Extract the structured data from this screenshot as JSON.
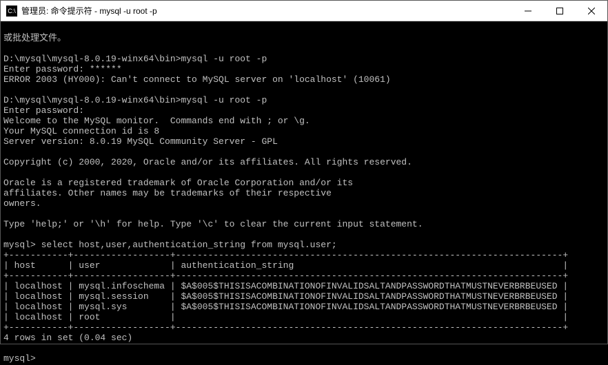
{
  "window": {
    "title": "管理员: 命令提示符 - mysql  -u root -p"
  },
  "term": {
    "l0": "或批处理文件。",
    "blank": "",
    "l1": "D:\\mysql\\mysql-8.0.19-winx64\\bin>mysql -u root -p",
    "l2": "Enter password: ******",
    "l3": "ERROR 2003 (HY000): Can't connect to MySQL server on 'localhost' (10061)",
    "l4": "D:\\mysql\\mysql-8.0.19-winx64\\bin>mysql -u root -p",
    "l5": "Enter password:",
    "l6": "Welcome to the MySQL monitor.  Commands end with ; or \\g.",
    "l7": "Your MySQL connection id is 8",
    "l8": "Server version: 8.0.19 MySQL Community Server - GPL",
    "l9": "Copyright (c) 2000, 2020, Oracle and/or its affiliates. All rights reserved.",
    "l10": "Oracle is a registered trademark of Oracle Corporation and/or its",
    "l11": "affiliates. Other names may be trademarks of their respective",
    "l12": "owners.",
    "l13": "Type 'help;' or '\\h' for help. Type '\\c' to clear the current input statement.",
    "l14": "mysql> select host,user,authentication_string from mysql.user;",
    "tbl_border": "+-----------+------------------+------------------------------------------------------------------------+",
    "tbl_header": "| host      | user             | authentication_string                                                  |",
    "tbl_r1": "| localhost | mysql.infoschema | $A$005$THISISACOMBINATIONOFINVALIDSALTANDPASSWORDTHATMUSTNEVERBRBEUSED |",
    "tbl_r2": "| localhost | mysql.session    | $A$005$THISISACOMBINATIONOFINVALIDSALTANDPASSWORDTHATMUSTNEVERBRBEUSED |",
    "tbl_r3": "| localhost | mysql.sys        | $A$005$THISISACOMBINATIONOFINVALIDSALTANDPASSWORDTHATMUSTNEVERBRBEUSED |",
    "tbl_r4": "| localhost | root             |                                                                        |",
    "l15": "4 rows in set (0.04 sec)",
    "l16": "mysql> "
  },
  "chart_data": {
    "type": "table",
    "title": "select host,user,authentication_string from mysql.user;",
    "columns": [
      "host",
      "user",
      "authentication_string"
    ],
    "rows": [
      [
        "localhost",
        "mysql.infoschema",
        "$A$005$THISISACOMBINATIONOFINVALIDSALTANDPASSWORDTHATMUSTNEVERBRBEUSED"
      ],
      [
        "localhost",
        "mysql.session",
        "$A$005$THISISACOMBINATIONOFINVALIDSALTANDPASSWORDTHATMUSTNEVERBRBEUSED"
      ],
      [
        "localhost",
        "mysql.sys",
        "$A$005$THISISACOMBINATIONOFINVALIDSALTANDPASSWORDTHATMUSTNEVERBRBEUSED"
      ],
      [
        "localhost",
        "root",
        ""
      ]
    ],
    "rows_in_set": 4,
    "elapsed_sec": 0.04
  }
}
